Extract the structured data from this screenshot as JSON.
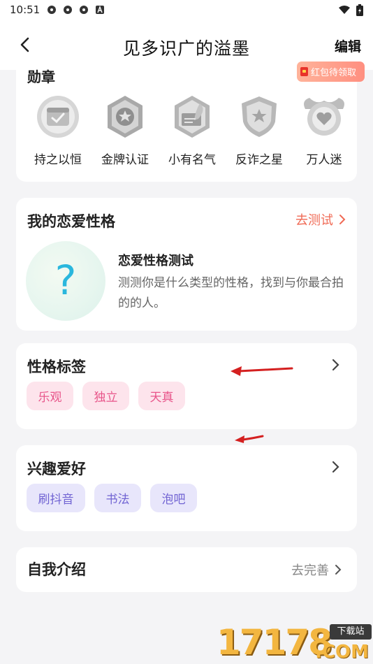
{
  "status_bar": {
    "time": "10:51",
    "app_icons": [
      "app-icon",
      "app-icon",
      "app-icon",
      "a-icon"
    ]
  },
  "header": {
    "title": "见多识广的溢墨",
    "edit_label": "编辑"
  },
  "redpacket": {
    "label": "红包待领取"
  },
  "badges": {
    "title": "勋章",
    "items": [
      {
        "label": "持之以恒",
        "icon": "calendar-badge-icon"
      },
      {
        "label": "金牌认证",
        "icon": "gold-cert-badge-icon"
      },
      {
        "label": "小有名气",
        "icon": "feather-badge-icon"
      },
      {
        "label": "反诈之星",
        "icon": "star-shield-badge-icon"
      },
      {
        "label": "万人迷",
        "icon": "heart-badge-icon"
      }
    ]
  },
  "love": {
    "title": "我的恋爱性格",
    "test_link": "去测试",
    "icon_text": "?",
    "sub_title": "恋爱性格测试",
    "desc": "测测你是什么类型的性格，找到与你最合拍的的人。"
  },
  "tags": {
    "title": "性格标签",
    "items": [
      "乐观",
      "独立",
      "天真"
    ],
    "color": "#e8558a"
  },
  "hobby": {
    "title": "兴趣爱好",
    "items": [
      "刷抖音",
      "书法",
      "泡吧"
    ],
    "color": "#7164d3"
  },
  "intro": {
    "title": "自我介绍",
    "link": "去完善"
  },
  "watermark": {
    "digits": "17178",
    "tag": "下载站",
    "suffix": ".COM"
  }
}
